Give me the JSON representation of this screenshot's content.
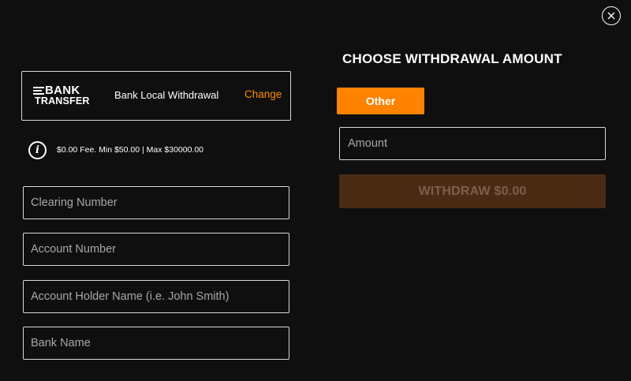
{
  "dialog": {
    "close_icon": "close-icon"
  },
  "payment_method": {
    "logo_line1": "BANK",
    "logo_line2": "TRANSFER",
    "name": "Bank Local Withdrawal",
    "change_label": "Change"
  },
  "fee": {
    "icon": "info-icon",
    "text": "$0.00 Fee. Min $50.00 | Max $30000.00"
  },
  "fields": {
    "clearing_number": {
      "placeholder": "Clearing Number",
      "value": ""
    },
    "account_number": {
      "placeholder": "Account Number",
      "value": ""
    },
    "account_holder": {
      "placeholder": "Account Holder Name (i.e. John Smith)",
      "value": ""
    },
    "bank_name": {
      "placeholder": "Bank Name",
      "value": ""
    }
  },
  "amount": {
    "title": "CHOOSE WITHDRAWAL AMOUNT",
    "other_label": "Other",
    "placeholder": "Amount",
    "value": "",
    "withdraw_label": "WITHDRAW $0.00"
  },
  "colors": {
    "accent": "#ff8200",
    "link": "#ff8a00",
    "background": "#0f0f0f",
    "disabled_button": "#4a2a12"
  }
}
